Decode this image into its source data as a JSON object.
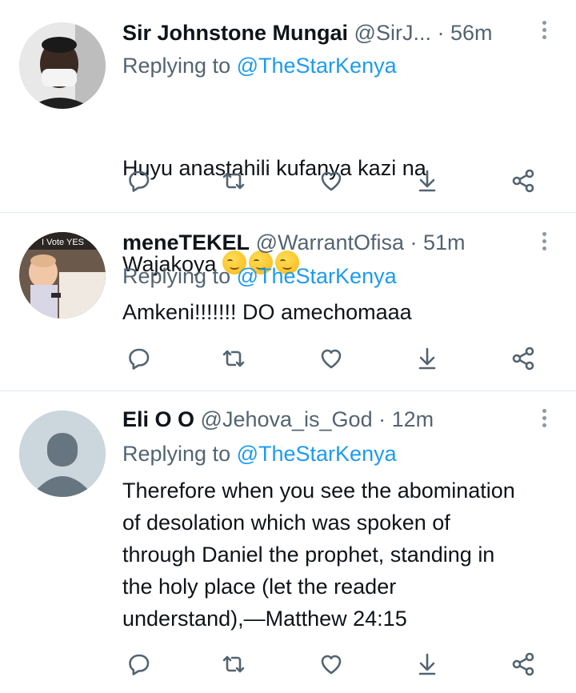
{
  "tweets": [
    {
      "name": "Sir Johnstone Mungai",
      "handle_time": "@SirJ...",
      "time": " · 56m",
      "replying_prefix": "Replying to ",
      "replying_handle": "@TheStarKenya",
      "text_line1": "Huyu anastahili kufanya kazi na",
      "text_line2": "Wajakoya ",
      "emoji": "smirking-face-emoji"
    },
    {
      "name": "meneTEKEL",
      "handle_time": "@WarrantOfisa · 51m",
      "replying_prefix": "Replying to ",
      "replying_handle": "@TheStarKenya",
      "text": "Amkeni!!!!!!! DO amechomaaa",
      "avatar_sign": "I Vote YES"
    },
    {
      "name": "Eli O O",
      "handle_time": "@Jehova_is_God · 12m",
      "replying_prefix": "Replying to ",
      "replying_handle": "@TheStarKenya",
      "text": "Therefore when you see the abomination\nof desolation which was spoken of\nthrough Daniel the prophet, standing in\nthe holy place (let the reader\nunderstand),—Matthew 24:15"
    }
  ],
  "colors": {
    "text": "#0f1419",
    "secondary": "#536471",
    "link": "#1d9bf0",
    "icon": "#536471",
    "divider": "#e1e8ed"
  },
  "icons": [
    "reply-icon",
    "retweet-icon",
    "like-icon",
    "download-icon",
    "share-icon",
    "more-icon"
  ]
}
